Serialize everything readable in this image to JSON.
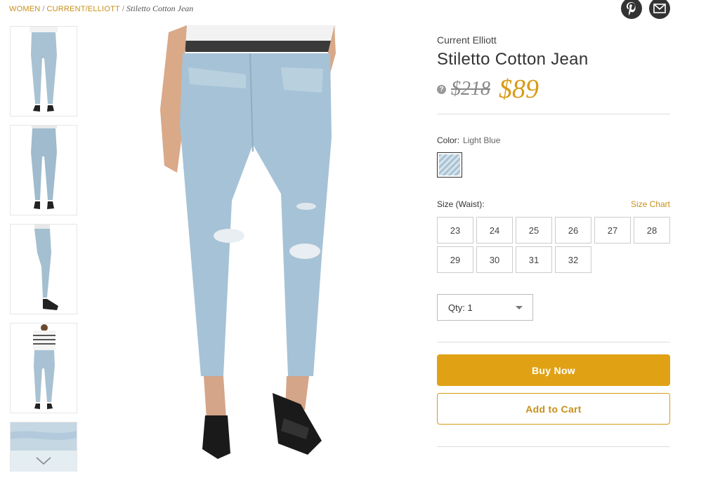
{
  "breadcrumb": {
    "women": "WOMEN",
    "brand": "CURRENT/ELLIOTT",
    "current": "Stiletto Cotton Jean",
    "sep": "/"
  },
  "share": {
    "pinterest_icon": "pinterest-icon",
    "email_icon": "email-icon"
  },
  "product": {
    "brand": "Current Elliott",
    "title": "Stiletto Cotton Jean",
    "info_symbol": "?",
    "original_price": "$218",
    "sale_price": "$89",
    "color_label": "Color:",
    "color_value": "Light Blue",
    "size_label": "Size (Waist):",
    "size_chart_label": "Size Chart",
    "sizes": [
      "23",
      "24",
      "25",
      "26",
      "27",
      "28",
      "29",
      "30",
      "31",
      "32"
    ],
    "qty_label": "Qty: 1",
    "buy_now_label": "Buy Now",
    "add_to_cart_label": "Add to Cart"
  },
  "colors": {
    "accent": "#d79c16",
    "button": "#e0a214",
    "denim": "#a9c3d3"
  },
  "thumbnail_nav_icon": "chevron-down-icon"
}
